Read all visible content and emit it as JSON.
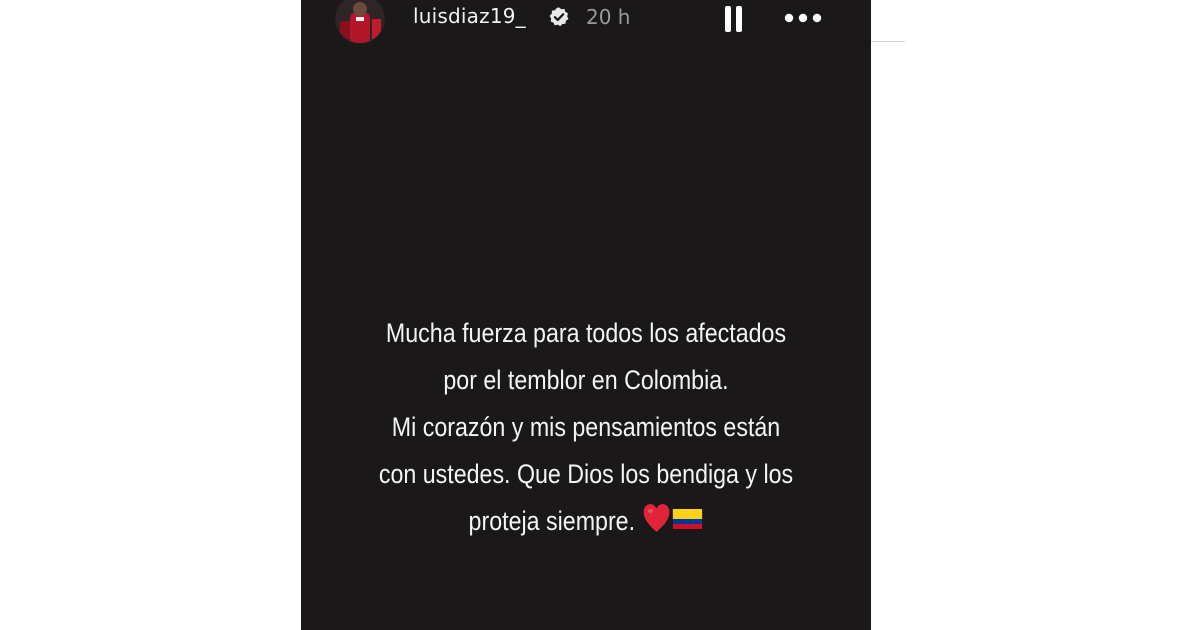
{
  "story": {
    "username": "luisdiaz19_",
    "time_ago": "20 h",
    "verified": true,
    "icons": {
      "avatar": "profile-avatar",
      "verified": "verified-badge-icon",
      "pause": "pause-icon",
      "more": "more-options-icon"
    },
    "text": {
      "line1": "Mucha fuerza para todos los afectados",
      "line2": "por el temblor en Colombia.",
      "line3": "Mi corazón y mis pensamientos están",
      "line4": "con ustedes. Que Dios los bendiga y los",
      "line5": "proteja siempre."
    },
    "emojis": [
      "red-heart-emoji",
      "colombia-flag-emoji"
    ],
    "colors": {
      "background": "#1a1818",
      "text": "#f4f4f4",
      "time": "#9a9a9a",
      "heart": "#e0243a",
      "flag_yellow": "#fcd116",
      "flag_blue": "#003893",
      "flag_red": "#ce1126"
    }
  }
}
